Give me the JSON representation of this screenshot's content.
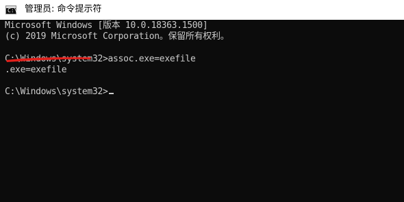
{
  "window": {
    "title": "管理员: 命令提示符",
    "icon": "console-icon",
    "icon_glyph": "C:\\"
  },
  "console": {
    "lines": [
      "Microsoft Windows [版本 10.0.18363.1500]",
      "(c) 2019 Microsoft Corporation。保留所有权利。",
      "C:\\Windows\\system32>assoc.exe=exefile",
      ".exe=exefile",
      "C:\\Windows\\system32>"
    ],
    "text_color": "#cccccc",
    "background_color": "#0c0c0c"
  },
  "annotation": {
    "type": "underline",
    "color": "#e0201b"
  }
}
